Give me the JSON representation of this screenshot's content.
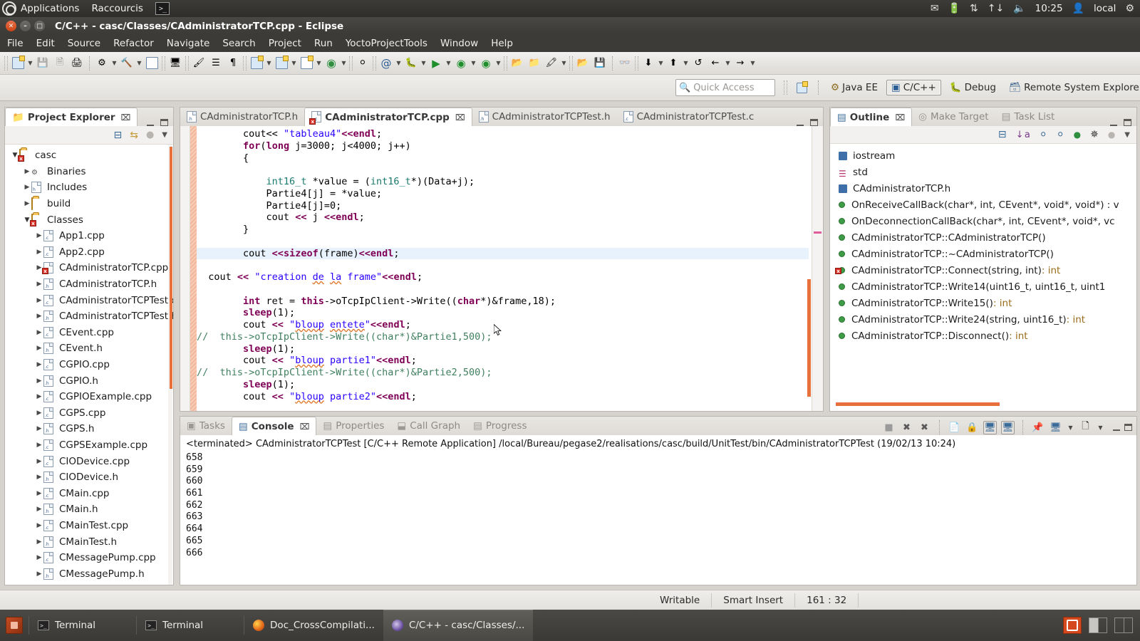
{
  "unity": {
    "apps_label": "Applications",
    "shortcuts_label": "Raccourcis",
    "terminal_icon": "terminal-icon",
    "clock": "10:25",
    "user": "local",
    "indicators": [
      "mail-icon",
      "battery-icon",
      "bluetooth-icon",
      "network-icon",
      "volume-icon"
    ]
  },
  "window": {
    "title": "C/C++ - casc/Classes/CAdministratorTCP.cpp - Eclipse",
    "close_glyph": "×",
    "min_glyph": "–",
    "max_glyph": "□"
  },
  "menubar": {
    "items": [
      "File",
      "Edit",
      "Source",
      "Refactor",
      "Navigate",
      "Search",
      "Project",
      "Run",
      "YoctoProjectTools",
      "Window",
      "Help"
    ]
  },
  "quick_access": {
    "placeholder": "Quick Access",
    "icon": "search-icon"
  },
  "perspectives": {
    "new_perspective_icon": "new-perspective-icon",
    "items": [
      {
        "label": "Java EE",
        "active": false,
        "icon": "java-ee-icon"
      },
      {
        "label": "C/C++",
        "active": true,
        "icon": "cpp-icon"
      },
      {
        "label": "Debug",
        "active": false,
        "icon": "debug-icon"
      },
      {
        "label": "Remote System Explorer",
        "active": false,
        "icon": "remote-system-icon"
      }
    ]
  },
  "project_explorer": {
    "tab_label": "Project Explorer",
    "tab_icon": "project-explorer-icon",
    "close_glyph": "⌧",
    "toolbar": [
      {
        "name": "collapse-all-icon"
      },
      {
        "name": "link-with-editor-icon"
      },
      {
        "name": "focus-on-active-task-icon"
      },
      {
        "name": "view-menu-icon"
      }
    ],
    "tree": [
      {
        "label": "casc",
        "indent": 0,
        "arrow": "open",
        "icon": "cpp-project-icon",
        "error": true
      },
      {
        "label": "Binaries",
        "indent": 1,
        "arrow": "closed",
        "icon": "binaries-icon",
        "error": false
      },
      {
        "label": "Includes",
        "indent": 1,
        "arrow": "closed",
        "icon": "includes-icon",
        "error": false
      },
      {
        "label": "build",
        "indent": 1,
        "arrow": "closed",
        "icon": "folder-icon",
        "error": false
      },
      {
        "label": "Classes",
        "indent": 1,
        "arrow": "open",
        "icon": "folder-icon",
        "error": true
      },
      {
        "label": "App1.cpp",
        "indent": 2,
        "arrow": "closed",
        "icon": "c-file-icon",
        "error": false
      },
      {
        "label": "App2.cpp",
        "indent": 2,
        "arrow": "closed",
        "icon": "c-file-icon",
        "error": false
      },
      {
        "label": "CAdministratorTCP.cpp",
        "indent": 2,
        "arrow": "closed",
        "icon": "c-file-icon",
        "error": true
      },
      {
        "label": "CAdministratorTCP.h",
        "indent": 2,
        "arrow": "closed",
        "icon": "h-file-icon",
        "error": false
      },
      {
        "label": "CAdministratorTCPTest.cpp",
        "indent": 2,
        "arrow": "closed",
        "icon": "c-file-icon",
        "error": false
      },
      {
        "label": "CAdministratorTCPTest.h",
        "indent": 2,
        "arrow": "closed",
        "icon": "h-file-icon",
        "error": false
      },
      {
        "label": "CEvent.cpp",
        "indent": 2,
        "arrow": "closed",
        "icon": "c-file-icon",
        "error": false
      },
      {
        "label": "CEvent.h",
        "indent": 2,
        "arrow": "closed",
        "icon": "h-file-icon",
        "error": false
      },
      {
        "label": "CGPIO.cpp",
        "indent": 2,
        "arrow": "closed",
        "icon": "c-file-icon",
        "error": false
      },
      {
        "label": "CGPIO.h",
        "indent": 2,
        "arrow": "closed",
        "icon": "h-file-icon",
        "error": false
      },
      {
        "label": "CGPIOExample.cpp",
        "indent": 2,
        "arrow": "closed",
        "icon": "c-file-icon",
        "error": false
      },
      {
        "label": "CGPS.cpp",
        "indent": 2,
        "arrow": "closed",
        "icon": "c-file-icon",
        "error": false
      },
      {
        "label": "CGPS.h",
        "indent": 2,
        "arrow": "closed",
        "icon": "h-file-icon",
        "error": false
      },
      {
        "label": "CGPSExample.cpp",
        "indent": 2,
        "arrow": "closed",
        "icon": "c-file-icon",
        "error": false
      },
      {
        "label": "CIODevice.cpp",
        "indent": 2,
        "arrow": "closed",
        "icon": "c-file-icon",
        "error": false
      },
      {
        "label": "CIODevice.h",
        "indent": 2,
        "arrow": "closed",
        "icon": "h-file-icon",
        "error": false
      },
      {
        "label": "CMain.cpp",
        "indent": 2,
        "arrow": "closed",
        "icon": "c-file-icon",
        "error": false
      },
      {
        "label": "CMain.h",
        "indent": 2,
        "arrow": "closed",
        "icon": "h-file-icon",
        "error": false
      },
      {
        "label": "CMainTest.cpp",
        "indent": 2,
        "arrow": "closed",
        "icon": "c-file-icon",
        "error": false
      },
      {
        "label": "CMainTest.h",
        "indent": 2,
        "arrow": "closed",
        "icon": "h-file-icon",
        "error": false
      },
      {
        "label": "CMessagePump.cpp",
        "indent": 2,
        "arrow": "closed",
        "icon": "c-file-icon",
        "error": false
      },
      {
        "label": "CMessagePump.h",
        "indent": 2,
        "arrow": "closed",
        "icon": "h-file-icon",
        "error": false
      }
    ]
  },
  "editor": {
    "tabs": [
      {
        "label": "CAdministratorTCP.h",
        "active": false,
        "icon": "h-file-icon",
        "error": false
      },
      {
        "label": "CAdministratorTCP.cpp",
        "active": true,
        "icon": "c-file-icon",
        "error": true
      },
      {
        "label": "CAdministratorTCPTest.h",
        "active": false,
        "icon": "h-file-icon",
        "error": false
      },
      {
        "label": "CAdministratorTCPTest.c",
        "active": false,
        "icon": "c-file-icon",
        "error": false
      }
    ],
    "code_lines": [
      {
        "indent": 8,
        "highlight": false,
        "parts": [
          {
            "t": "cout<< ",
            "c": "op"
          },
          {
            "t": "\"tableau4\"",
            "c": "str"
          },
          {
            "t": "<<",
            "c": "kw"
          },
          {
            "t": "endl",
            "c": "kw"
          },
          {
            "t": ";",
            "c": "op"
          }
        ]
      },
      {
        "indent": 8,
        "highlight": false,
        "parts": [
          {
            "t": "for",
            "c": "kw"
          },
          {
            "t": "(",
            "c": "op"
          },
          {
            "t": "long",
            "c": "kw"
          },
          {
            "t": " j=3000; j<4000; j++)",
            "c": "op"
          }
        ]
      },
      {
        "indent": 8,
        "highlight": false,
        "parts": [
          {
            "t": "{",
            "c": "op"
          }
        ]
      },
      {
        "indent": 0,
        "highlight": false,
        "parts": []
      },
      {
        "indent": 12,
        "highlight": false,
        "parts": [
          {
            "t": "int16_t",
            "c": "typ"
          },
          {
            "t": " *value = (",
            "c": "op"
          },
          {
            "t": "int16_t",
            "c": "typ"
          },
          {
            "t": "*)(Data+j);",
            "c": "op"
          }
        ]
      },
      {
        "indent": 12,
        "highlight": false,
        "parts": [
          {
            "t": "Partie4[j] = *value;",
            "c": "op"
          }
        ]
      },
      {
        "indent": 12,
        "highlight": false,
        "parts": [
          {
            "t": "Partie4[j]=0;",
            "c": "op"
          }
        ]
      },
      {
        "indent": 12,
        "highlight": false,
        "parts": [
          {
            "t": "cout ",
            "c": "op"
          },
          {
            "t": "<<",
            "c": "kw"
          },
          {
            "t": " j ",
            "c": "op"
          },
          {
            "t": "<<",
            "c": "kw"
          },
          {
            "t": "endl",
            "c": "kw"
          },
          {
            "t": ";",
            "c": "op"
          }
        ]
      },
      {
        "indent": 8,
        "highlight": false,
        "parts": [
          {
            "t": "}",
            "c": "op"
          }
        ]
      },
      {
        "indent": 0,
        "highlight": false,
        "parts": []
      },
      {
        "indent": 8,
        "highlight": true,
        "parts": [
          {
            "t": "cout ",
            "c": "op"
          },
          {
            "t": "<<",
            "c": "kw"
          },
          {
            "t": "sizeof",
            "c": "kw"
          },
          {
            "t": "(frame)",
            "c": "op"
          },
          {
            "t": "<<",
            "c": "kw"
          },
          {
            "t": "endl",
            "c": "kw"
          },
          {
            "t": ";",
            "c": "op"
          }
        ]
      },
      {
        "indent": 0,
        "highlight": false,
        "parts": []
      },
      {
        "indent": 2,
        "highlight": false,
        "parts": [
          {
            "t": "cout ",
            "c": "op"
          },
          {
            "t": "<<",
            "c": "kw"
          },
          {
            "t": " ",
            "c": "op"
          },
          {
            "t": "\"creation ",
            "c": "str"
          },
          {
            "t": "de",
            "c": "str spell"
          },
          {
            "t": " ",
            "c": "str"
          },
          {
            "t": "la",
            "c": "str spell"
          },
          {
            "t": " frame\"",
            "c": "str"
          },
          {
            "t": "<<",
            "c": "kw"
          },
          {
            "t": "endl",
            "c": "kw"
          },
          {
            "t": ";",
            "c": "op"
          }
        ]
      },
      {
        "indent": 0,
        "highlight": false,
        "parts": []
      },
      {
        "indent": 8,
        "highlight": false,
        "parts": [
          {
            "t": "int",
            "c": "kw"
          },
          {
            "t": " ret = ",
            "c": "op"
          },
          {
            "t": "this",
            "c": "kw"
          },
          {
            "t": "->oTcpIpClient->Write((",
            "c": "op"
          },
          {
            "t": "char",
            "c": "kw"
          },
          {
            "t": "*)&frame,18);",
            "c": "op"
          }
        ]
      },
      {
        "indent": 8,
        "highlight": false,
        "parts": [
          {
            "t": "sleep",
            "c": "kw"
          },
          {
            "t": "(1);",
            "c": "op"
          }
        ]
      },
      {
        "indent": 8,
        "highlight": false,
        "parts": [
          {
            "t": "cout ",
            "c": "op"
          },
          {
            "t": "<<",
            "c": "kw"
          },
          {
            "t": " ",
            "c": "op"
          },
          {
            "t": "\"",
            "c": "str"
          },
          {
            "t": "bloup",
            "c": "str spell"
          },
          {
            "t": " ",
            "c": "str"
          },
          {
            "t": "entete",
            "c": "str spell"
          },
          {
            "t": "\"",
            "c": "str"
          },
          {
            "t": "<<",
            "c": "kw"
          },
          {
            "t": "endl",
            "c": "kw"
          },
          {
            "t": ";",
            "c": "op"
          }
        ]
      },
      {
        "indent": 0,
        "highlight": false,
        "parts": [
          {
            "t": "//  this->oTcpIpClient->Write((char*)&Partie1,500);",
            "c": "cmt"
          }
        ]
      },
      {
        "indent": 8,
        "highlight": false,
        "parts": [
          {
            "t": "sleep",
            "c": "kw"
          },
          {
            "t": "(1);",
            "c": "op"
          }
        ]
      },
      {
        "indent": 8,
        "highlight": false,
        "parts": [
          {
            "t": "cout ",
            "c": "op"
          },
          {
            "t": "<<",
            "c": "kw"
          },
          {
            "t": " ",
            "c": "op"
          },
          {
            "t": "\"",
            "c": "str"
          },
          {
            "t": "bloup",
            "c": "str spell"
          },
          {
            "t": " partie1\"",
            "c": "str"
          },
          {
            "t": "<<",
            "c": "kw"
          },
          {
            "t": "endl",
            "c": "kw"
          },
          {
            "t": ";",
            "c": "op"
          }
        ]
      },
      {
        "indent": 0,
        "highlight": false,
        "parts": [
          {
            "t": "//  this->oTcpIpClient->Write((char*)&Partie2,500);",
            "c": "cmt"
          }
        ]
      },
      {
        "indent": 8,
        "highlight": false,
        "parts": [
          {
            "t": "sleep",
            "c": "kw"
          },
          {
            "t": "(1);",
            "c": "op"
          }
        ]
      },
      {
        "indent": 8,
        "highlight": false,
        "parts": [
          {
            "t": "cout ",
            "c": "op"
          },
          {
            "t": "<<",
            "c": "kw"
          },
          {
            "t": " ",
            "c": "op"
          },
          {
            "t": "\"",
            "c": "str"
          },
          {
            "t": "bloup",
            "c": "str spell"
          },
          {
            "t": " partie2\"",
            "c": "str"
          },
          {
            "t": "<<",
            "c": "kw"
          },
          {
            "t": "endl",
            "c": "kw"
          },
          {
            "t": ";",
            "c": "op"
          }
        ]
      }
    ]
  },
  "outline": {
    "tabs": [
      {
        "label": "Outline",
        "active": true,
        "icon": "outline-icon"
      },
      {
        "label": "Make Target",
        "active": false,
        "icon": "make-target-icon"
      },
      {
        "label": "Task List",
        "active": false,
        "icon": "task-list-icon"
      }
    ],
    "close_glyph": "⌧",
    "toolbar": [
      {
        "name": "collapse-all-icon"
      },
      {
        "name": "sort-icon"
      },
      {
        "name": "hide-fields-icon"
      },
      {
        "name": "hide-static-icon"
      },
      {
        "name": "hide-non-public-icon"
      },
      {
        "name": "hide-macros-icon"
      },
      {
        "name": "focus-on-active-task-icon"
      },
      {
        "name": "view-menu-icon"
      }
    ],
    "items": [
      {
        "label": "iostream",
        "kind": "include",
        "rettype": "",
        "error": false
      },
      {
        "label": "std",
        "kind": "namespace",
        "rettype": "",
        "error": false
      },
      {
        "label": "CAdministratorTCP.h",
        "kind": "include",
        "rettype": "",
        "error": false
      },
      {
        "label": "OnReceiveCallBack(char*, int, CEvent*, void*, void*) : v",
        "kind": "method",
        "rettype": "",
        "error": false
      },
      {
        "label": "OnDeconnectionCallBack(char*, int, CEvent*, void*, vc",
        "kind": "method",
        "rettype": "",
        "error": false
      },
      {
        "label": "CAdministratorTCP::CAdministratorTCP()",
        "kind": "method",
        "rettype": "",
        "error": false
      },
      {
        "label": "CAdministratorTCP::~CAdministratorTCP()",
        "kind": "method",
        "rettype": "",
        "error": false
      },
      {
        "label": "CAdministratorTCP::Connect(string, int) ",
        "kind": "method",
        "rettype": ": int",
        "error": true
      },
      {
        "label": "CAdministratorTCP::Write14(uint16_t, uint16_t, uint1",
        "kind": "method",
        "rettype": "",
        "error": false
      },
      {
        "label": "CAdministratorTCP::Write15() ",
        "kind": "method",
        "rettype": ": int",
        "error": false
      },
      {
        "label": "CAdministratorTCP::Write24(string, uint16_t) ",
        "kind": "method",
        "rettype": ": int",
        "error": false
      },
      {
        "label": "CAdministratorTCP::Disconnect() ",
        "kind": "method",
        "rettype": ": int",
        "error": false
      }
    ]
  },
  "console": {
    "tabs": [
      {
        "label": "Tasks",
        "active": false,
        "icon": "tasks-icon"
      },
      {
        "label": "Console",
        "active": true,
        "icon": "console-icon"
      },
      {
        "label": "Properties",
        "active": false,
        "icon": "properties-icon"
      },
      {
        "label": "Call Graph",
        "active": false,
        "icon": "call-graph-icon"
      },
      {
        "label": "Progress",
        "active": false,
        "icon": "progress-icon"
      }
    ],
    "close_glyph": "⌧",
    "toolbar": [
      {
        "name": "terminate-icon",
        "pressed": false
      },
      {
        "name": "remove-launch-icon",
        "pressed": false
      },
      {
        "name": "remove-all-terminated-icon",
        "pressed": false
      },
      {
        "name": "clear-console-icon",
        "pressed": false
      },
      {
        "name": "scroll-lock-icon",
        "pressed": false
      },
      {
        "name": "show-console-on-output-icon",
        "pressed": true
      },
      {
        "name": "show-console-on-error-icon",
        "pressed": true
      },
      {
        "name": "pin-console-icon",
        "pressed": false
      },
      {
        "name": "display-selected-console-icon",
        "pressed": false
      },
      {
        "name": "open-console-icon",
        "pressed": false
      }
    ],
    "header": "<terminated> CAdministratorTCPTest [C/C++ Remote Application] /local/Bureau/pegase2/realisations/casc/build/UnitTest/bin/CAdministratorTCPTest (19/02/13 10:24)",
    "output": [
      "658",
      "659",
      "660",
      "661",
      "662",
      "663",
      "664",
      "665",
      "666"
    ]
  },
  "statusbar": {
    "writable": "Writable",
    "insert_mode": "Smart Insert",
    "position": "161 : 32"
  },
  "taskbar": {
    "items": [
      {
        "label": "Terminal",
        "icon": "terminal-icon",
        "active": false
      },
      {
        "label": "Terminal",
        "icon": "terminal-icon",
        "active": false
      },
      {
        "label": "Doc_CrossCompilati...",
        "icon": "firefox-icon",
        "active": false
      },
      {
        "label": "C/C++ - casc/Classes/...",
        "icon": "eclipse-icon",
        "active": true
      }
    ]
  },
  "colors": {
    "accent_orange": "#e8703a",
    "keyword": "#7f0055",
    "string": "#2a00ff",
    "comment": "#3f7f5f",
    "type": "#1a7a6e",
    "highlight_line": "#e8f2fd"
  }
}
